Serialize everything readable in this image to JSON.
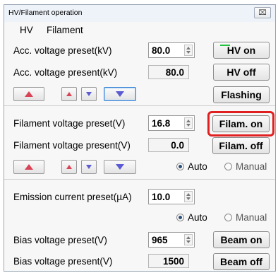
{
  "window": {
    "title": "HV/Filament operation",
    "close_label": "⌧"
  },
  "menu": [
    "HV",
    "Filament"
  ],
  "hv": {
    "acc_preset_label": "Acc. voltage preset(kV)",
    "acc_preset_value": "80.0",
    "acc_present_label": "Acc. voltage present(kV)",
    "acc_present_value": "80.0",
    "hv_on_label": "HV on",
    "hv_off_label": "HV off",
    "flashing_label": "Flashing",
    "hv_on_indicator_color": "#24c340"
  },
  "filament": {
    "preset_label": "Filament voltage preset(V)",
    "preset_value": "16.8",
    "present_label": "Filament voltage present(V)",
    "present_value": "0.0",
    "on_label": "Filam. on",
    "off_label": "Filam. off",
    "mode_auto": "Auto",
    "mode_manual": "Manual",
    "selected_mode": "Auto"
  },
  "emission": {
    "preset_label": "Emission current preset(µA)",
    "preset_value": "10.0",
    "mode_auto": "Auto",
    "mode_manual": "Manual",
    "selected_mode": "Auto"
  },
  "bias": {
    "preset_label": "Bias voltage preset(V)",
    "preset_value": "965",
    "present_label": "Bias voltage present(V)",
    "present_value": "1500",
    "beam_on_label": "Beam on",
    "beam_off_label": "Beam off"
  },
  "colors": {
    "increase_arrow": "#d94355",
    "decrease_arrow": "#5b5bd3",
    "highlight_box": "#e02020"
  }
}
